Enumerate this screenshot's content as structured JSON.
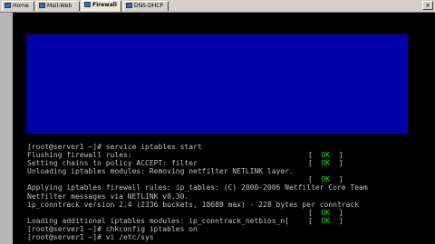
{
  "tabs": [
    {
      "label": "Home",
      "icon": "home-icon",
      "active": false
    },
    {
      "label": "Mail-Web",
      "icon": "server-icon",
      "active": false
    },
    {
      "label": "Firewall",
      "icon": "server-icon",
      "active": true
    },
    {
      "label": "DNS-DHCP",
      "icon": "server-icon",
      "active": false
    }
  ],
  "close_glyph": "×",
  "console": {
    "lines": [
      {
        "text": "[root@server1 ~]# service iptables start"
      },
      {
        "text": "Flushing firewall rules:",
        "status": "OK"
      },
      {
        "text": "Setting chains to policy ACCEPT: filter",
        "status": "OK"
      },
      {
        "text": "Unloading iptables modules: Removing netfilter NETLINK layer."
      },
      {
        "text": "",
        "status": "OK"
      },
      {
        "text": "Applying iptables firewall rules: ip_tables: (C) 2000-2006 Netfilter Core Team"
      },
      {
        "text": "Netfilter messages via NETLINK v0.30."
      },
      {
        "text": "ip_conntrack version 2.4 (2336 buckets, 18688 max) - 228 bytes per conntrack"
      },
      {
        "text": "",
        "status": "OK"
      },
      {
        "text": "Loading additional iptables modules: ip_conntrack_netbios_n[",
        "status": "OK"
      },
      {
        "text": "[root@server1 ~]# chkconfig iptables on"
      },
      {
        "text": "[root@server1 ~]# vi /etc/sys"
      }
    ]
  },
  "colors": {
    "background": "#000000",
    "text": "#c0c0c0",
    "ok": "#22d822",
    "panel": "#0000a8"
  }
}
